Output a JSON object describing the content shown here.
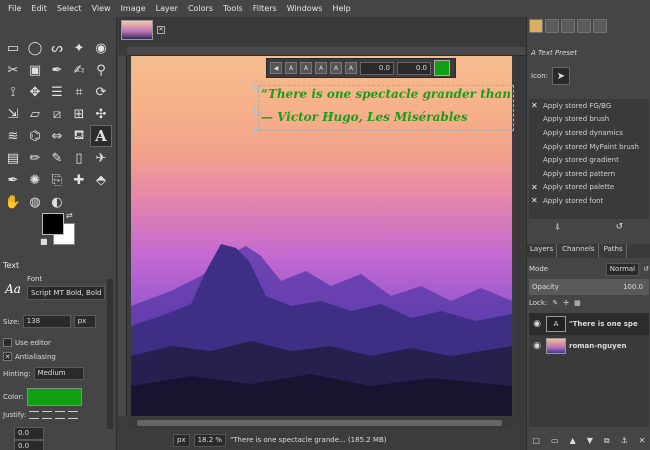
{
  "menu": [
    "File",
    "Edit",
    "Select",
    "View",
    "Image",
    "Layer",
    "Colors",
    "Tools",
    "Filters",
    "Windows",
    "Help"
  ],
  "toolbox": {
    "tools": [
      "rect-select-icon",
      "ellipse-select-icon",
      "lasso-icon",
      "fuzzy-select-icon",
      "color-select-icon",
      "scissors-icon",
      "foreground-select-icon",
      "paths-icon",
      "color-picker-icon",
      "zoom-icon",
      "measure-icon",
      "move-icon",
      "align-icon",
      "crop-icon",
      "rotate-icon",
      "scale-icon",
      "shear-icon",
      "perspective-icon",
      "unified-transform-icon",
      "handle-transform-icon",
      "warp-icon",
      "cage-icon",
      "flip-icon",
      "bucket-fill-icon",
      "text-icon",
      "gradient-icon",
      "pencil-icon",
      "paintbrush-icon",
      "eraser-icon",
      "airbrush-icon",
      "ink-icon",
      "mypaint-brush-icon",
      "clone-icon",
      "heal-icon",
      "perspective-clone-icon",
      "smudge-icon",
      "blur-icon",
      "dodge-burn-icon"
    ],
    "options_title": "Text",
    "font_label": "Font",
    "font_preview": "Aa",
    "font_name": "Script MT Bold, Bold",
    "size_label": "Size:",
    "size_value": "138",
    "size_unit": "px",
    "use_editor_label": "Use editor",
    "antialiasing_label": "Antialiasing",
    "hinting_label": "Hinting:",
    "hinting_value": "Medium",
    "color_label": "Color:",
    "text_color": "#11a011",
    "justify_label": "Justify:",
    "indent_value": "0.0",
    "line_spacing_value": "0.0"
  },
  "canvas": {
    "text_line1": "“There is one spectacle grander than the sea",
    "text_line2": "— Victor Hugo, Les Misérables",
    "toolbar": {
      "baseline_value": "0.0",
      "kerning_value": "0.0",
      "color": "#11a011"
    }
  },
  "statusbar": {
    "unit": "px",
    "zoom": "18.2 %",
    "message": "\"There is one spectacle grande... (185.2 MB)"
  },
  "dock": {
    "preset_title": "Text Preset",
    "icon_label": "Icon:",
    "options": [
      {
        "label": "Apply stored FG/BG",
        "checked": true
      },
      {
        "label": "Apply stored brush",
        "checked": false
      },
      {
        "label": "Apply stored dynamics",
        "checked": false
      },
      {
        "label": "Apply stored MyPaint brush",
        "checked": false
      },
      {
        "label": "Apply stored gradient",
        "checked": false
      },
      {
        "label": "Apply stored pattern",
        "checked": false
      },
      {
        "label": "Apply stored palette",
        "checked": true
      },
      {
        "label": "Apply stored font",
        "checked": true
      }
    ],
    "layers_tab": "Layers",
    "channels_tab": "Channels",
    "paths_tab": "Paths",
    "mode_label": "Mode",
    "mode_value": "Normal",
    "opacity_label": "Opacity",
    "opacity_value": "100.0",
    "lock_label": "Lock:",
    "layers": [
      {
        "name": "\"There is one spe",
        "thumb": "text"
      },
      {
        "name": "roman-nguyen",
        "thumb": "image"
      }
    ]
  }
}
